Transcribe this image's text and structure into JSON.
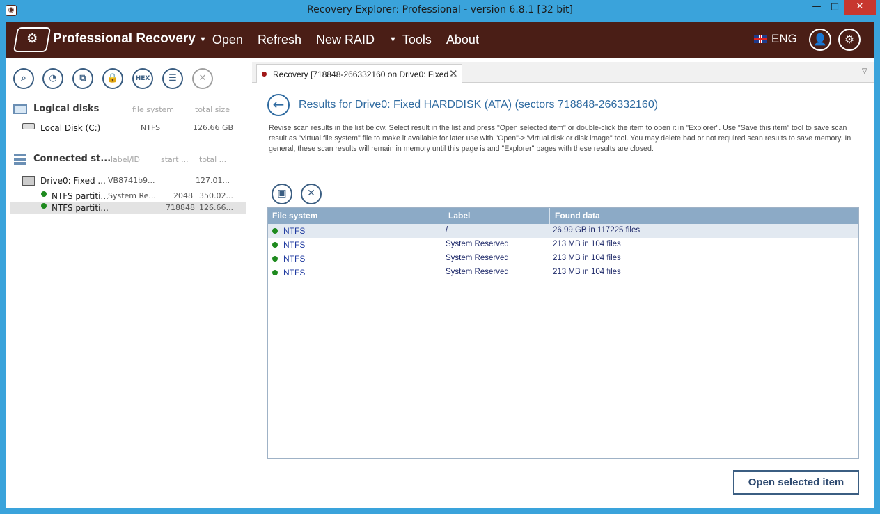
{
  "window": {
    "title": "Recovery Explorer: Professional - version 6.8.1 [32 bit]"
  },
  "header": {
    "brand": "Professional Recovery",
    "menu": {
      "open": "Open",
      "refresh": "Refresh",
      "new_raid": "New RAID",
      "tools": "Tools",
      "about": "About"
    },
    "language": "ENG"
  },
  "left": {
    "toolbar_icons": [
      "search-icon",
      "scan-icon",
      "disk-image-icon",
      "lock-icon",
      "hex-icon",
      "list-icon",
      "close-icon"
    ],
    "hex_label": "HEX",
    "logical": {
      "title": "Logical disks",
      "col_fs": "file system",
      "col_size": "total size",
      "items": [
        {
          "name": "Local Disk (C:)",
          "fs": "NTFS",
          "size": "126.66 GB"
        }
      ]
    },
    "connected": {
      "title": "Connected st...",
      "col_label": "label/ID",
      "col_start": "start ...",
      "col_total": "total ...",
      "drive": {
        "name": "Drive0: Fixed ...",
        "id": "VB8741b9...",
        "total": "127.01..."
      },
      "partitions": [
        {
          "name": "NTFS partiti...",
          "label": "System Re...",
          "start": "2048",
          "total": "350.02..."
        },
        {
          "name": "NTFS partiti...",
          "label": "",
          "start": "718848",
          "total": "126.66..."
        }
      ]
    }
  },
  "tab": {
    "label": "Recovery [718848-266332160 on Drive0: Fixed ..."
  },
  "main": {
    "title": "Results for Drive0: Fixed HARDDISK (ATA) (sectors 718848-266332160)",
    "description": "Revise scan results in the list below. Select result in the list and press \"Open selected item\" or double-click the item to open it in \"Explorer\". Use \"Save this item\" tool to save scan result as \"virtual file system\" file to make it available for later use with \"Open\"->\"Virtual disk or disk image\" tool. You may delete bad or not required scan results to save memory. In general, these scan results will remain in memory until this page is and \"Explorer\" pages with these results are closed.",
    "grid": {
      "headers": {
        "fs": "File system",
        "label": "Label",
        "found": "Found data"
      },
      "rows": [
        {
          "fs": "NTFS",
          "label": "/",
          "found": "26.99 GB in 117225 files"
        },
        {
          "fs": "NTFS",
          "label": "System Reserved",
          "found": "213 MB in 104 files"
        },
        {
          "fs": "NTFS",
          "label": "System Reserved",
          "found": "213 MB in 104 files"
        },
        {
          "fs": "NTFS",
          "label": "System Reserved",
          "found": "213 MB in 104 files"
        }
      ]
    },
    "open_button": "Open selected item"
  },
  "colors": {
    "titlebar": "#3aa3db",
    "header": "#4a1e16",
    "accent": "#2e6aa0",
    "status_ok": "#1e8a1e",
    "grid_header": "#8caac6"
  }
}
